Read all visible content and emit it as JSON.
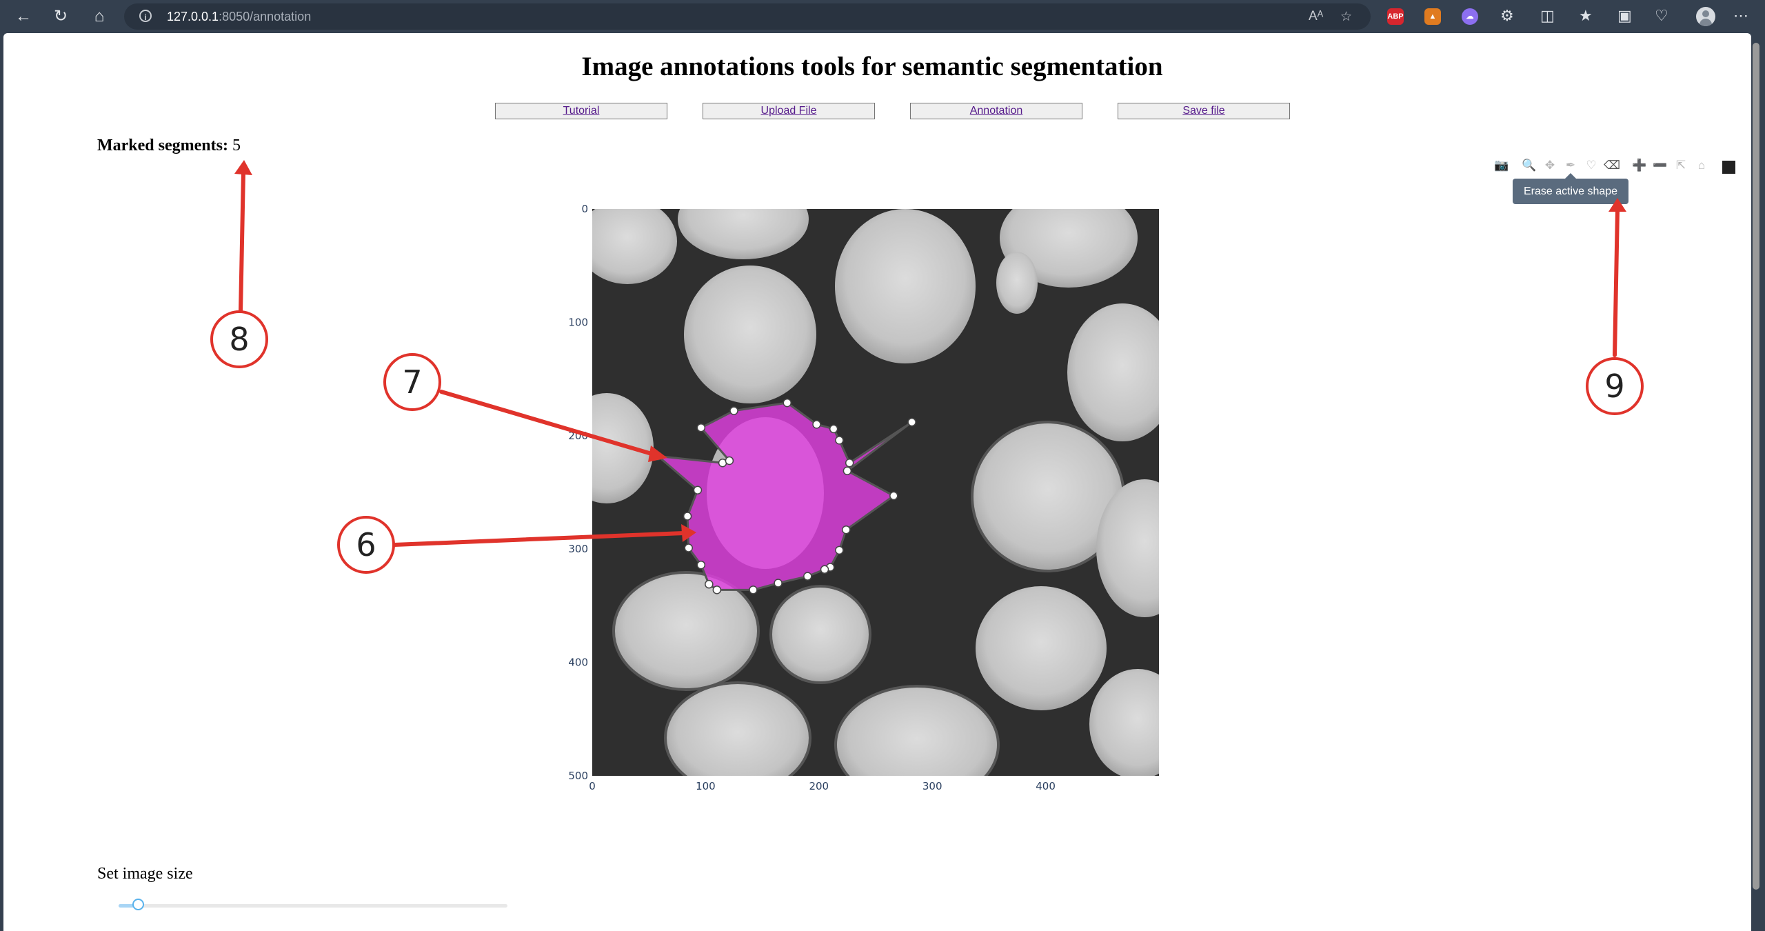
{
  "browser": {
    "url_host": "127.0.0.1",
    "url_rest": ":8050/annotation",
    "extension_abp": "ABP"
  },
  "page": {
    "title": "Image annotations tools for semantic segmentation",
    "nav_buttons": [
      "Tutorial",
      "Upload File",
      "Annotation",
      "Save file"
    ],
    "segments_label": "Marked segments:",
    "segments_count": "5",
    "tooltip": "Erase active shape",
    "image_size_label": "Set image size",
    "slider_value_fraction": 0.05
  },
  "chart_data": {
    "type": "image-annotation",
    "x_ticks": [
      "0",
      "100",
      "200",
      "300",
      "400"
    ],
    "y_ticks": [
      "0",
      "100",
      "200",
      "300",
      "400",
      "500"
    ],
    "xlim": [
      0,
      500
    ],
    "ylim": [
      500,
      0
    ],
    "active_shape_fill": "#e040e0",
    "active_shape_vertices": [
      [
        96,
        193
      ],
      [
        125,
        178
      ],
      [
        172,
        171
      ],
      [
        198,
        190
      ],
      [
        213,
        194
      ],
      [
        218,
        204
      ],
      [
        227,
        224
      ],
      [
        282,
        188
      ],
      [
        225,
        231
      ],
      [
        266,
        253
      ],
      [
        224,
        283
      ],
      [
        218,
        301
      ],
      [
        210,
        316
      ],
      [
        205,
        318
      ],
      [
        190,
        324
      ],
      [
        164,
        330
      ],
      [
        142,
        336
      ],
      [
        110,
        336
      ],
      [
        103,
        331
      ],
      [
        96,
        314
      ],
      [
        85,
        299
      ],
      [
        84,
        271
      ],
      [
        93,
        248
      ],
      [
        58,
        218
      ],
      [
        115,
        224
      ],
      [
        121,
        222
      ]
    ]
  },
  "annotations": [
    {
      "label": "8"
    },
    {
      "label": "7"
    },
    {
      "label": "6"
    },
    {
      "label": "9"
    }
  ],
  "colors": {
    "annotation_red": "#e0332b",
    "shape_magenta": "#e040e0"
  }
}
